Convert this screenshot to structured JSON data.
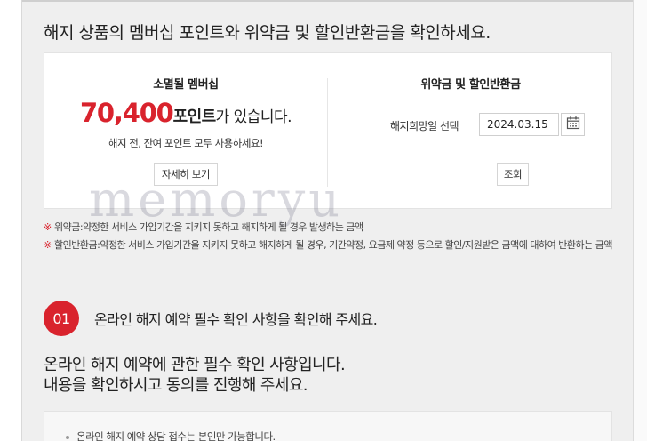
{
  "headline": "해지 상품의 멤버십 포인트와 위약금 및 할인반환금을 확인하세요.",
  "membership": {
    "title": "소멸될 멤버십",
    "points_value": "70,400",
    "points_unit": "포인트",
    "points_suffix": "가 있습니다.",
    "note": "해지 전, 잔여 포인트 모두 사용하세요!",
    "detail_button": "자세히 보기"
  },
  "penalty": {
    "title": "위약금 및 할인반환금",
    "date_label": "해지희망일 선택",
    "date_value": "2024.03.15",
    "calendar_icon": "calendar-icon",
    "lookup_button": "조회"
  },
  "notes": [
    {
      "mark": "※",
      "term": "위약금: ",
      "text": "약정한 서비스 가입기간을 지키지 못하고 해지하게 될 경우 발생하는 금액"
    },
    {
      "mark": "※",
      "term": "할인반환금: ",
      "text": "약정한 서비스 가입기간을 지키지 못하고 해지하게 될 경우, 기간약정, 요금제 약정 등으로 할인/지원받은 금액에 대하여 반환하는 금액"
    }
  ],
  "step": {
    "number": "01",
    "text": "온라인 해지 예약 필수 확인 사항을 확인해 주세요."
  },
  "intro": {
    "line1": "온라인 해지 예약에 관한 필수 확인 사항입니다.",
    "line2": "내용을 확인하시고 동의를 진행해 주세요."
  },
  "requirements": {
    "first_item": "온라인 해지 예약 상담 접수는 본인만 가능합니다."
  },
  "watermark": "memoryu",
  "colors": {
    "accent": "#d9232d",
    "background": "#efefef",
    "panel": "#ffffff"
  }
}
